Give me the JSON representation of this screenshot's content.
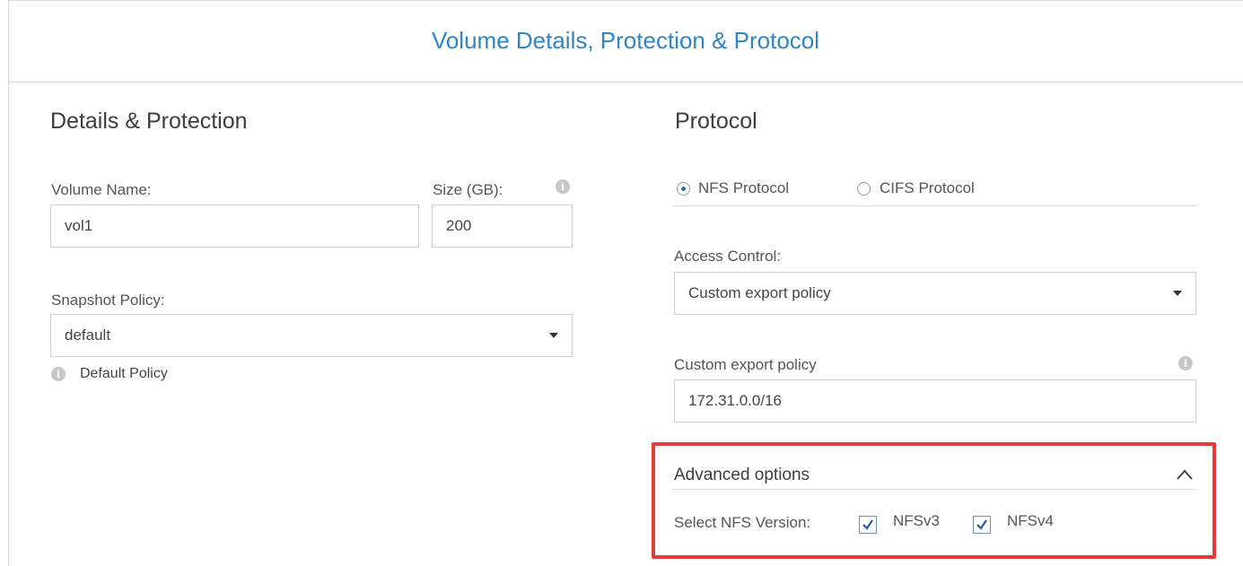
{
  "header": {
    "title": "Volume Details, Protection & Protocol"
  },
  "details": {
    "title": "Details & Protection",
    "volume_name_label": "Volume Name:",
    "volume_name_value": "vol1",
    "size_label": "Size (GB):",
    "size_value": "200",
    "snapshot_label": "Snapshot Policy:",
    "snapshot_value": "default",
    "snapshot_hint": "Default Policy"
  },
  "protocol": {
    "title": "Protocol",
    "options": [
      {
        "label": "NFS Protocol",
        "selected": true
      },
      {
        "label": "CIFS Protocol",
        "selected": false
      }
    ],
    "access_control_label": "Access Control:",
    "access_control_value": "Custom export policy",
    "export_policy_label": "Custom export policy",
    "export_policy_value": "172.31.0.0/16"
  },
  "advanced": {
    "title": "Advanced options",
    "nfs_version_label": "Select NFS Version:",
    "versions": [
      {
        "label": "NFSv3",
        "checked": true
      },
      {
        "label": "NFSv4",
        "checked": true
      }
    ]
  },
  "icons": {
    "info": "info-icon",
    "caret": "caret-down-icon",
    "collapse": "chevron-up-icon",
    "check": "checkmark-icon"
  },
  "colors": {
    "accent": "#2c86c9",
    "highlight": "#e53b3b",
    "checkbox_border": "#6d8fb8"
  }
}
